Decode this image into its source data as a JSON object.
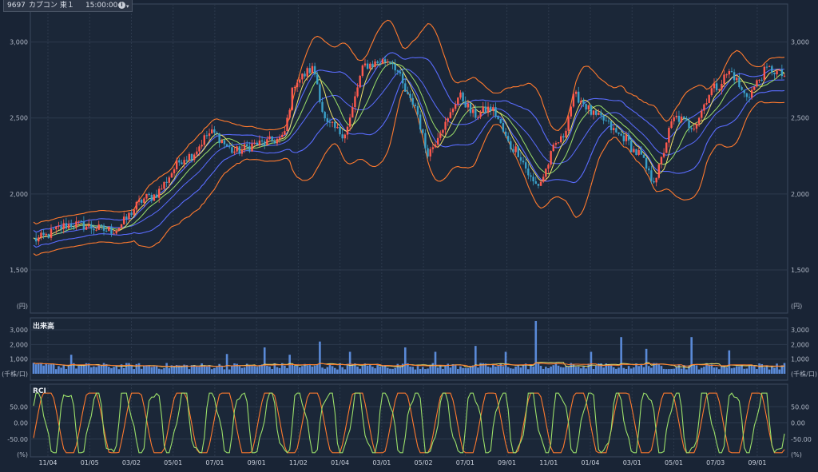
{
  "header": {
    "code": "9697",
    "name": "カプコン",
    "market": "東１",
    "time": "15:00:00"
  },
  "colors": {
    "background": "#192435",
    "grid": "#2d3a4d",
    "up_candle": "#ff5a4e",
    "down_candle": "#3aa0c8",
    "bollinger_outer": "#ff7a2e",
    "bollinger_inner": "#5a6cff",
    "ma_short": "#f0e36a",
    "ma_mid": "#9be06a",
    "volume_bar": "#5a8ad8",
    "rci_fast": "#9be06a",
    "rci_slow": "#ff7a2e"
  },
  "chart_data": [
    {
      "type": "candlestick",
      "panel": "price",
      "unit_label": "(円)",
      "yticks": [
        "1,500",
        "2,000",
        "2,500",
        "3,000"
      ],
      "ylim": [
        1300,
        3250
      ],
      "x_tick_labels": [
        "11/04",
        "01/05",
        "03/02",
        "05/01",
        "07/01",
        "09/01",
        "11/02",
        "01/04",
        "03/01",
        "05/02",
        "07/01",
        "09/01",
        "11/01",
        "01/04",
        "03/01",
        "05/01",
        "07/03",
        "09/01"
      ],
      "close_anchors": [
        [
          0,
          1700
        ],
        [
          5,
          1800
        ],
        [
          10,
          1760
        ],
        [
          15,
          1980
        ],
        [
          20,
          2250
        ],
        [
          23,
          2400
        ],
        [
          26,
          2280
        ],
        [
          29,
          2330
        ],
        [
          32,
          2360
        ],
        [
          34,
          2750
        ],
        [
          36,
          2820
        ],
        [
          38,
          2450
        ],
        [
          40,
          2400
        ],
        [
          43,
          2850
        ],
        [
          46,
          2880
        ],
        [
          49,
          2600
        ],
        [
          51,
          2280
        ],
        [
          53,
          2450
        ],
        [
          55,
          2640
        ],
        [
          57,
          2520
        ],
        [
          59,
          2560
        ],
        [
          62,
          2300
        ],
        [
          65,
          2060
        ],
        [
          68,
          2350
        ],
        [
          70,
          2640
        ],
        [
          73,
          2500
        ],
        [
          76,
          2380
        ],
        [
          78,
          2270
        ],
        [
          80,
          2100
        ],
        [
          83,
          2500
        ],
        [
          85,
          2450
        ],
        [
          88,
          2700
        ],
        [
          90,
          2800
        ],
        [
          92,
          2650
        ],
        [
          95,
          2820
        ],
        [
          97,
          2780
        ]
      ],
      "grid": true
    },
    {
      "type": "bar",
      "panel": "volume",
      "title": "出来高",
      "unit_label": "(千株/口)",
      "yticks": [
        "1,000",
        "2,000",
        "3,000"
      ],
      "ylim": [
        0,
        3600
      ],
      "baseline_level": 650,
      "spikes": [
        [
          5,
          1300
        ],
        [
          25,
          1350
        ],
        [
          30,
          1800
        ],
        [
          33,
          1300
        ],
        [
          37,
          2200
        ],
        [
          41,
          1500
        ],
        [
          48,
          1800
        ],
        [
          52,
          1500
        ],
        [
          57,
          1900
        ],
        [
          61,
          1500
        ],
        [
          65,
          3600
        ],
        [
          72,
          1500
        ],
        [
          76,
          2500
        ],
        [
          79,
          1700
        ],
        [
          85,
          2500
        ],
        [
          90,
          1600
        ]
      ]
    },
    {
      "type": "line",
      "panel": "rci",
      "title": "RCI",
      "unit_label": "(%)",
      "yticks": [
        "-50.00",
        "0.00",
        "50.00"
      ],
      "ylim": [
        -100,
        100
      ]
    }
  ]
}
